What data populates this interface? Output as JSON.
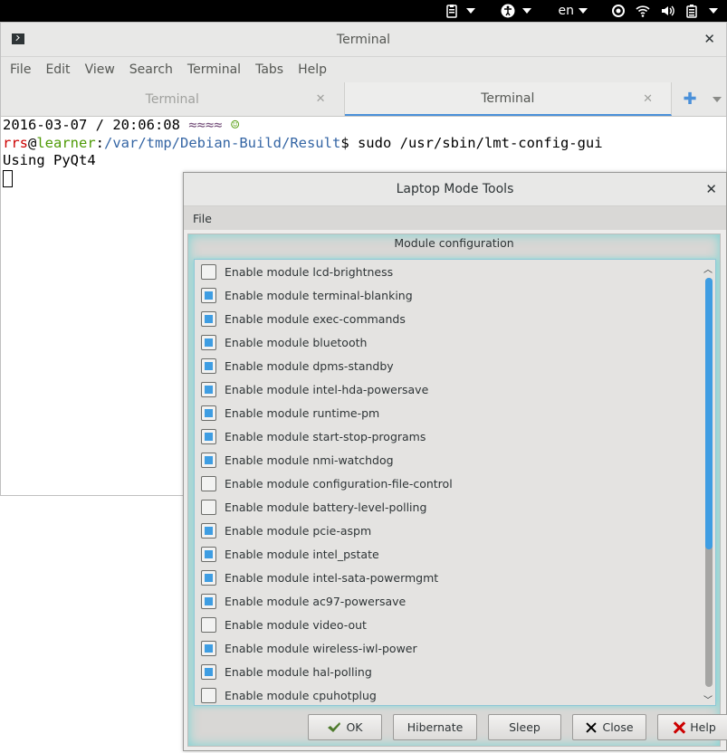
{
  "topbar": {
    "keyboard_layout": "en"
  },
  "terminal": {
    "window_title": "Terminal",
    "menu": [
      "File",
      "Edit",
      "View",
      "Search",
      "Terminal",
      "Tabs",
      "Help"
    ],
    "tabs": [
      {
        "label": "Terminal",
        "active": false
      },
      {
        "label": "Terminal",
        "active": true
      }
    ],
    "lines": {
      "l1_prefix": "2016-03-07 / 20:06:08 ",
      "l1_wave": "≈≈≈≈",
      "l1_smiley": "☺",
      "l2_user": "rrs",
      "l2_at": "@",
      "l2_host": "learner",
      "l2_colon": ":",
      "l2_path": "/var/tmp/Debian-Build/Result",
      "l2_cmd": "$ sudo /usr/sbin/lmt-config-gui",
      "l3": "Using PyQt4"
    }
  },
  "dialog": {
    "title": "Laptop Mode Tools",
    "menu_file": "File",
    "group_title": "Module configuration",
    "modules": [
      {
        "label": "Enable module lcd-brightness",
        "checked": false
      },
      {
        "label": "Enable module terminal-blanking",
        "checked": true
      },
      {
        "label": "Enable module exec-commands",
        "checked": true
      },
      {
        "label": "Enable module bluetooth",
        "checked": true
      },
      {
        "label": "Enable module dpms-standby",
        "checked": true
      },
      {
        "label": "Enable module intel-hda-powersave",
        "checked": true
      },
      {
        "label": "Enable module runtime-pm",
        "checked": true
      },
      {
        "label": "Enable module start-stop-programs",
        "checked": true
      },
      {
        "label": "Enable module nmi-watchdog",
        "checked": true
      },
      {
        "label": "Enable module configuration-file-control",
        "checked": false
      },
      {
        "label": "Enable module battery-level-polling",
        "checked": false
      },
      {
        "label": "Enable module pcie-aspm",
        "checked": true
      },
      {
        "label": "Enable module intel_pstate",
        "checked": true
      },
      {
        "label": "Enable module intel-sata-powermgmt",
        "checked": true
      },
      {
        "label": "Enable module ac97-powersave",
        "checked": true
      },
      {
        "label": "Enable module video-out",
        "checked": false
      },
      {
        "label": "Enable module wireless-iwl-power",
        "checked": true
      },
      {
        "label": "Enable module hal-polling",
        "checked": true
      },
      {
        "label": "Enable module cpuhotplug",
        "checked": false
      }
    ],
    "buttons": {
      "ok": "OK",
      "hibernate": "Hibernate",
      "sleep": "Sleep",
      "close": "Close",
      "help": "Help"
    }
  },
  "colors": {
    "accent": "#3e9de2",
    "prompt_user": "#cc0000",
    "prompt_host": "#4e9a06",
    "prompt_path": "#3465a4"
  }
}
